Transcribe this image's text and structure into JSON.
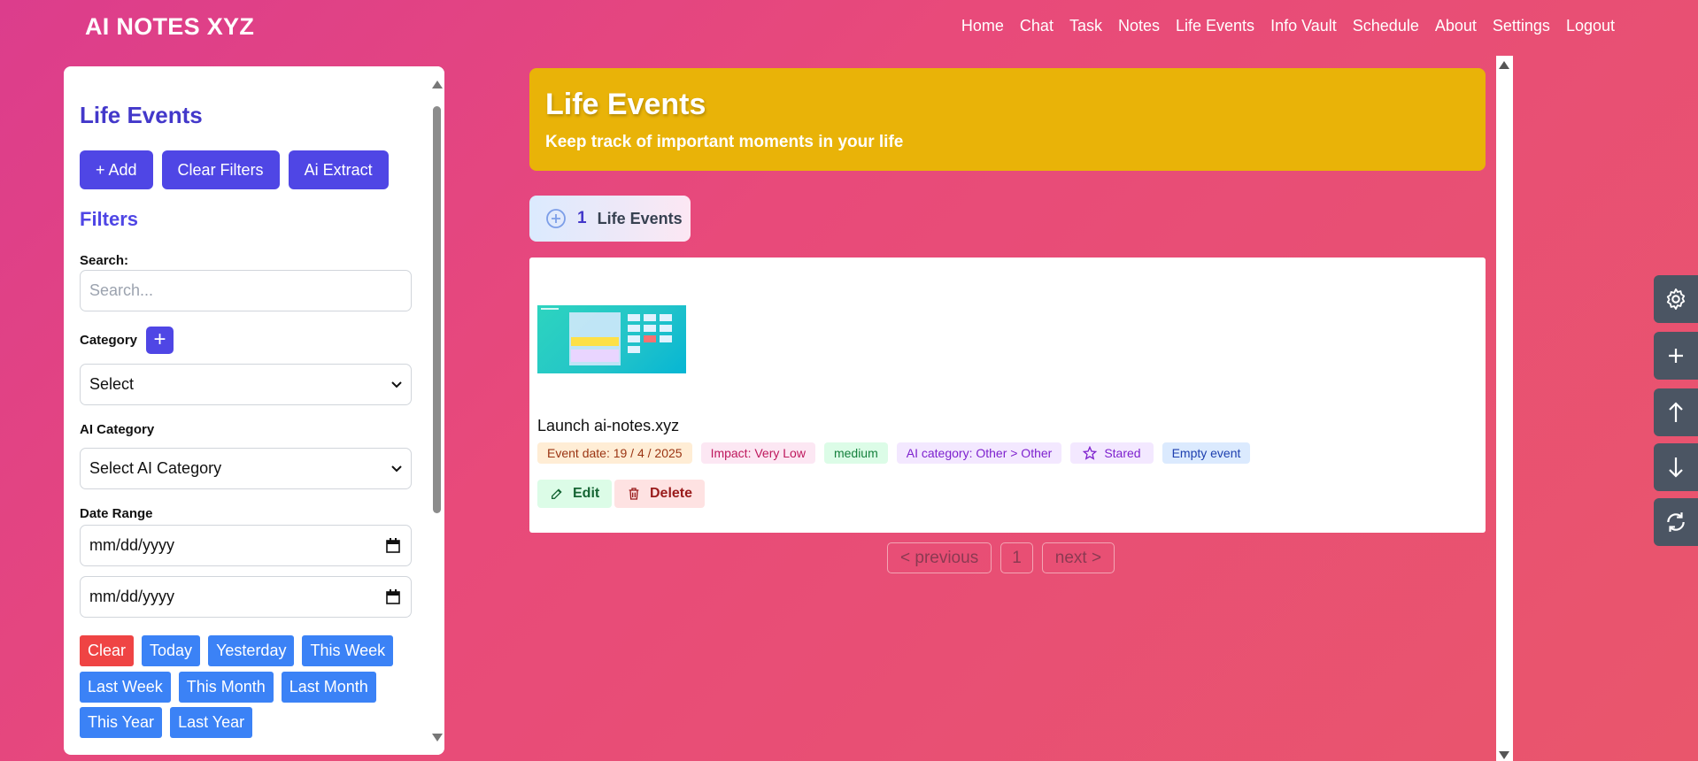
{
  "nav": {
    "brand": "AI NOTES XYZ",
    "links": [
      "Home",
      "Chat",
      "Task",
      "Notes",
      "Life Events",
      "Info Vault",
      "Schedule",
      "About",
      "Settings",
      "Logout"
    ]
  },
  "sidebar": {
    "title": "Life Events",
    "actions": {
      "add": "+ Add",
      "clear_filters": "Clear Filters",
      "ai_extract": "Ai Extract"
    },
    "filters_heading": "Filters",
    "search": {
      "label": "Search:",
      "placeholder": "Search..."
    },
    "category": {
      "label": "Category",
      "add_symbol": "+",
      "value": "Select"
    },
    "ai_category": {
      "label": "AI Category",
      "value": "Select AI Category"
    },
    "date_range": {
      "label": "Date Range",
      "start_placeholder": "mm/dd/yyyy",
      "end_placeholder": "mm/dd/yyyy"
    },
    "quick_dates": [
      "Clear",
      "Today",
      "Yesterday",
      "This Week",
      "Last Week",
      "This Month",
      "Last Month",
      "This Year",
      "Last Year"
    ]
  },
  "hero": {
    "title": "Life Events",
    "subtitle": "Keep track of important moments in your life"
  },
  "summary": {
    "count": "1",
    "label": "Life Events"
  },
  "event": {
    "title": "Launch ai-notes.xyz",
    "tags": {
      "date": "Event date: 19 / 4 / 2025",
      "impact": "Impact: Very Low",
      "priority": "medium",
      "ai_category": "AI category: Other > Other",
      "star": "Stared",
      "empty": "Empty event"
    },
    "edit": "Edit",
    "delete": "Delete"
  },
  "pagination": {
    "previous": "< previous",
    "page": "1",
    "next": "next >"
  },
  "colors": {
    "accent": "#4f46e5",
    "hero": "#e9b308",
    "quick_date": "#3b82f6",
    "clear": "#ef4444",
    "tool": "#4b5563"
  },
  "icons": [
    "gear-icon",
    "plus-icon",
    "arrow-up-icon",
    "arrow-down-icon",
    "refresh-icon",
    "plus-circle-icon",
    "star-icon",
    "edit-icon",
    "trash-icon",
    "calendar-icon",
    "chevron-down-icon"
  ]
}
